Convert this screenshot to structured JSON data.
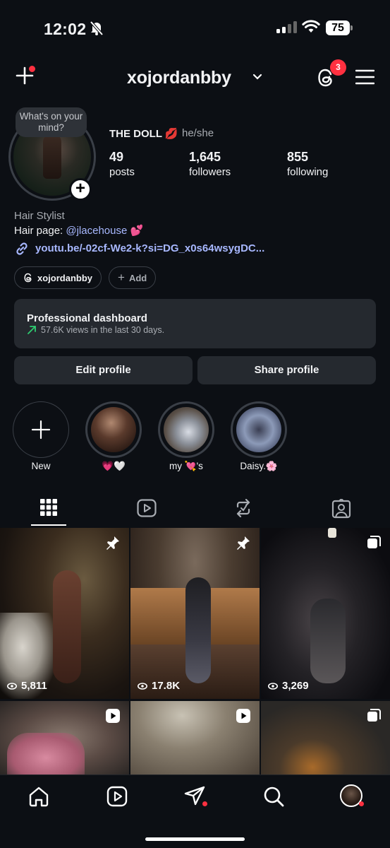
{
  "status": {
    "time": "12:02",
    "battery": "75"
  },
  "header": {
    "username": "xojordanbby",
    "threads_badge": "3"
  },
  "profile": {
    "note": "What's on your mind?",
    "display_name": "THE DOLL 💋",
    "pronouns": "he/she",
    "stats": [
      {
        "value": "49",
        "label": "posts"
      },
      {
        "value": "1,645",
        "label": "followers"
      },
      {
        "value": "855",
        "label": "following"
      }
    ],
    "category": "Hair Stylist",
    "bio_prefix": "Hair page: ",
    "bio_mention": "@jlacehouse",
    "bio_suffix": " 💕",
    "link": "youtu.be/-02cf-We2-k?si=DG_x0s64wsygDC..."
  },
  "chips": {
    "threads": "xojordanbby",
    "add": "Add"
  },
  "dashboard": {
    "title": "Professional dashboard",
    "subtitle": "57.6K views in the last 30 days."
  },
  "buttons": {
    "edit": "Edit profile",
    "share": "Share profile"
  },
  "highlights": [
    {
      "label": "New"
    },
    {
      "label": "💗🤍"
    },
    {
      "label": "my 💘's"
    },
    {
      "label": "Daisy.🌸"
    }
  ],
  "tabs": [
    "grid-icon",
    "reels-icon",
    "reposts-icon",
    "tagged-icon"
  ],
  "posts": [
    {
      "views": "5,811",
      "badge": "pin-icon"
    },
    {
      "views": "17.8K",
      "badge": "pin-icon"
    },
    {
      "views": "3,269",
      "badge": "carousel-icon"
    },
    {
      "views": "",
      "badge": "reel-icon"
    },
    {
      "views": "",
      "badge": "reel-icon"
    },
    {
      "views": "",
      "badge": "carousel-icon"
    }
  ],
  "colors": {
    "background": "#0c0f14",
    "surface": "#25292f",
    "accent_link": "#a8b8ff",
    "notification": "#ff3040"
  }
}
